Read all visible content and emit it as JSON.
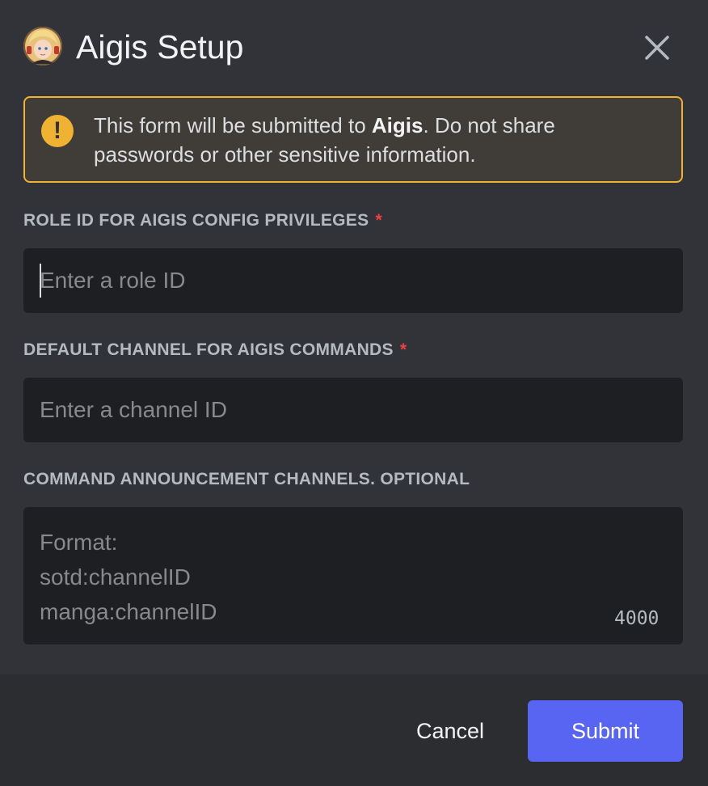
{
  "modal": {
    "title": "Aigis Setup",
    "avatar_icon": "bot-avatar",
    "close_icon": "close-icon"
  },
  "notice": {
    "icon": "warning-icon",
    "icon_glyph": "!",
    "text_prefix": "This form will be submitted to ",
    "bot_name": "Aigis",
    "text_suffix": ". Do not share passwords or other sensitive information.",
    "color": "#f0b232"
  },
  "fields": [
    {
      "label": "Role ID for Aigis config privileges",
      "required_marker": "*",
      "placeholder": "Enter a role ID",
      "value": ""
    },
    {
      "label": "Default channel for Aigis commands",
      "required_marker": "*",
      "placeholder": "Enter a channel ID",
      "value": ""
    },
    {
      "label": "Command announcement channels. Optional",
      "placeholder": "Format:\nsotd:channelID\nmanga:channelID",
      "value": "",
      "char_limit": "4000"
    }
  ],
  "footer": {
    "cancel_label": "Cancel",
    "submit_label": "Submit"
  },
  "colors": {
    "background": "#313338",
    "footer_bg": "#2b2d31",
    "input_bg": "#1e1f22",
    "accent": "#5865f2",
    "required": "#f23f43",
    "warning": "#f0b232"
  }
}
